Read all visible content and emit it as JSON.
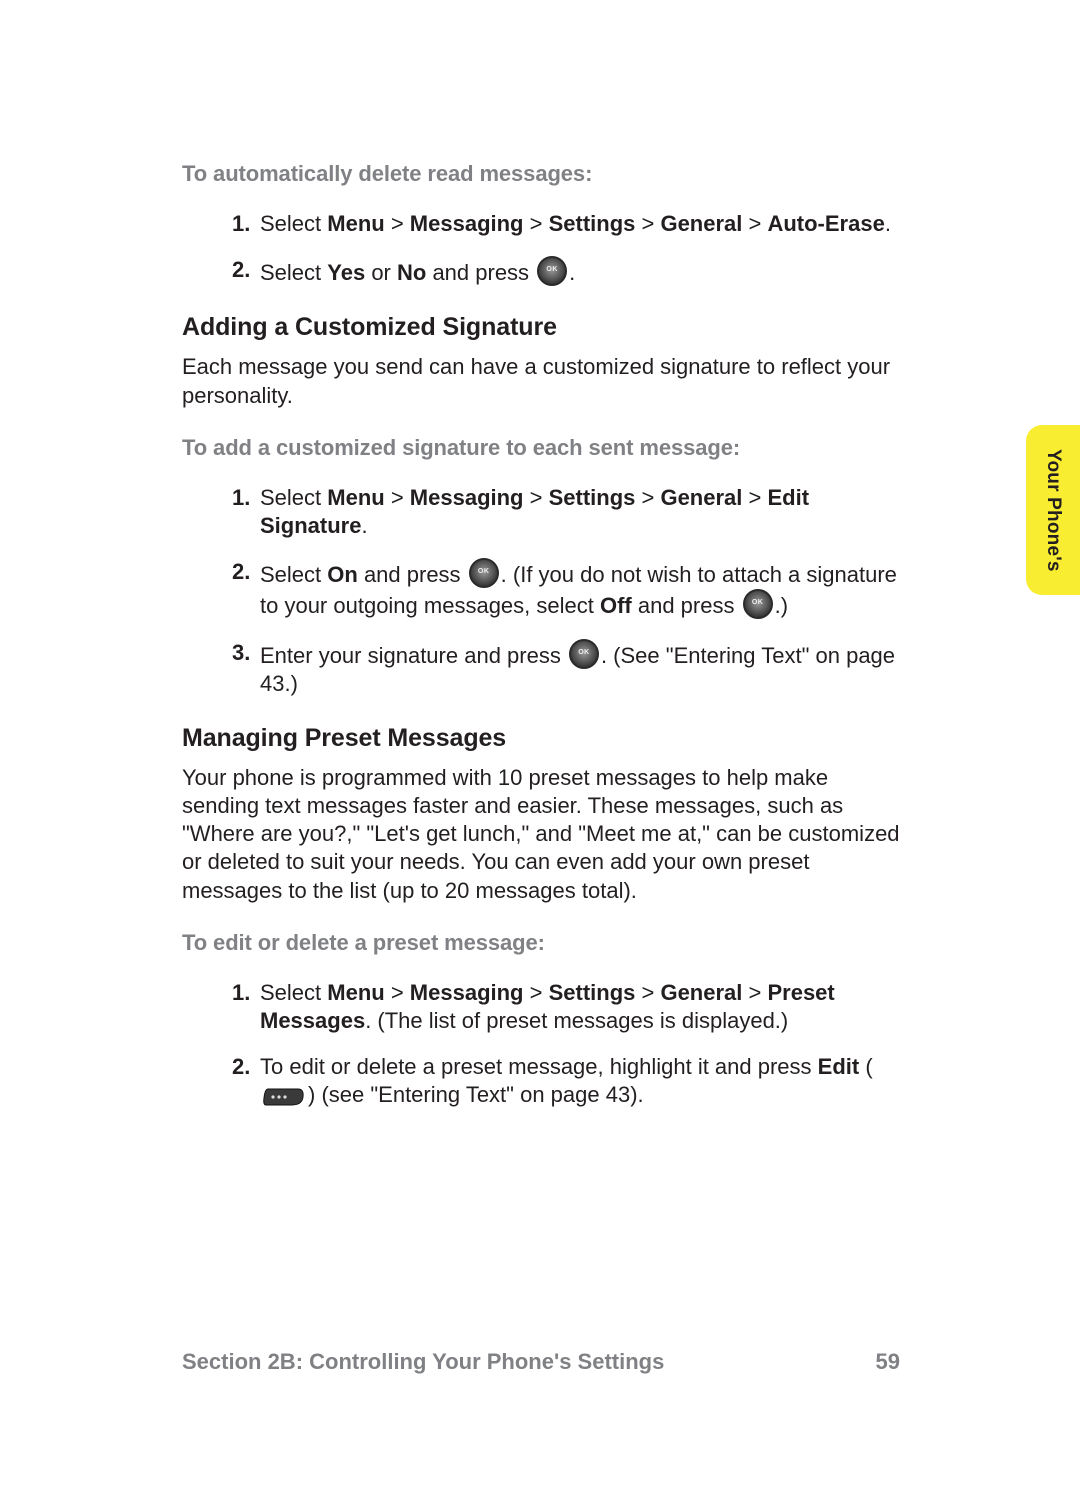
{
  "sideTab": "Your Phone's",
  "section1": {
    "subhead": "To automatically delete read messages:",
    "steps": [
      {
        "num": "1.",
        "prefix": "Select ",
        "path": [
          "Menu",
          "Messaging",
          "Settings",
          "General",
          "Auto-Erase"
        ],
        "suffix": "."
      },
      {
        "num": "2.",
        "parts": {
          "a": "Select ",
          "b": "Yes",
          "c": " or ",
          "d": "No",
          "e": " and press ",
          "f": "."
        }
      }
    ]
  },
  "section2": {
    "heading": "Adding a Customized Signature",
    "body": "Each message you send can have a customized signature to reflect your personality.",
    "subhead": "To add a customized signature to each sent message:",
    "steps": [
      {
        "num": "1.",
        "prefix": "Select ",
        "path": [
          "Menu",
          "Messaging",
          "Settings",
          "General",
          "Edit Signature"
        ],
        "suffix": "."
      },
      {
        "num": "2.",
        "p": {
          "a": "Select ",
          "b": "On",
          "c": " and press ",
          "d": ". (If you do not wish to attach a signature to your outgoing messages, select ",
          "e": "Off",
          "f": " and press ",
          "g": ".)"
        }
      },
      {
        "num": "3.",
        "p": {
          "a": "Enter your signature and press ",
          "b": ". (See \"Entering Text\" on page 43.)"
        }
      }
    ]
  },
  "section3": {
    "heading": "Managing Preset Messages",
    "body": "Your phone is programmed with 10 preset messages to help make sending text messages faster and easier. These messages, such as \"Where are you?,\" \"Let's get lunch,\" and \"Meet me at,\" can be customized or deleted to suit your needs. You can even add your own preset messages to the list (up to 20 messages total).",
    "subhead": "To edit or delete a preset message:",
    "steps": [
      {
        "num": "1.",
        "prefix": "Select ",
        "path": [
          "Menu",
          "Messaging",
          "Settings",
          "General",
          "Preset Messages"
        ],
        "suffixText": ". (The list of preset messages is displayed.)"
      },
      {
        "num": "2.",
        "p": {
          "a": "To edit or delete a preset message, highlight it and press ",
          "b": "Edit",
          "c": " (",
          "d": ") (see \"Entering Text\" on page 43)."
        }
      }
    ]
  },
  "footer": {
    "left": "Section 2B: Controlling Your Phone's Settings",
    "right": "59"
  },
  "sep": " > "
}
